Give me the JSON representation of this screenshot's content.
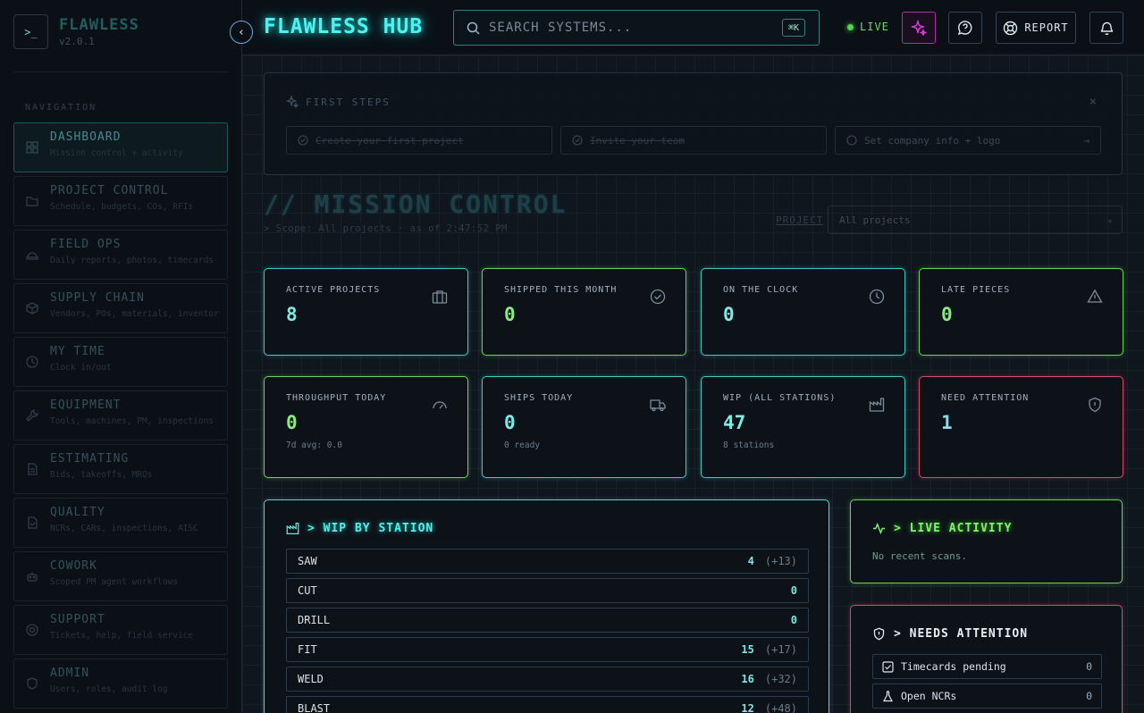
{
  "brand": {
    "name": "FLAWLESS",
    "version": "v2.0.1",
    "icon": ">_"
  },
  "sidebar": {
    "nav_title": "NAVIGATION",
    "items": [
      {
        "label": "DASHBOARD",
        "sub": "Mission control + activity",
        "icon": "grid-icon",
        "active": true
      },
      {
        "label": "PROJECT CONTROL",
        "sub": "Schedule, budgets, COs, RFIs",
        "icon": "folder-icon"
      },
      {
        "label": "FIELD OPS",
        "sub": "Daily reports, photos, timecards",
        "icon": "hardhat-icon"
      },
      {
        "label": "SUPPLY CHAIN",
        "sub": "Vendors, POs, materials, inventory",
        "icon": "package-icon"
      },
      {
        "label": "MY TIME",
        "sub": "Clock in/out",
        "icon": "clock-icon"
      },
      {
        "label": "EQUIPMENT",
        "sub": "Tools, machines, PM, inspections",
        "icon": "wrench-icon"
      },
      {
        "label": "ESTIMATING",
        "sub": "Bids, takeoffs, MRQs",
        "icon": "document-icon"
      },
      {
        "label": "QUALITY",
        "sub": "NCRs, CARs, inspections, AISC",
        "icon": "file-check-icon"
      },
      {
        "label": "COWORK",
        "sub": "Scoped PM agent workflows",
        "icon": "bot-icon"
      },
      {
        "label": "SUPPORT",
        "sub": "Tickets, help, field service",
        "icon": "lifebuoy-icon"
      },
      {
        "label": "ADMIN",
        "sub": "Users, roles, audit log",
        "icon": "shield-icon"
      }
    ]
  },
  "header": {
    "title": "FLAWLESS HUB",
    "search_placeholder": "SEARCH SYSTEMS...",
    "search_shortcut": "⌘K",
    "live_label": "LIVE",
    "report_label": "REPORT",
    "collapse_glyph": "‹"
  },
  "first_steps": {
    "title": "FIRST STEPS",
    "close": "×",
    "steps": [
      {
        "label": "Create your first project",
        "done": true
      },
      {
        "label": "Invite your team",
        "done": true
      },
      {
        "label": "Set company info + logo",
        "done": false,
        "arrow": "→"
      }
    ]
  },
  "mission": {
    "title": "// MISSION CONTROL",
    "scope": "> Scope: All projects · as of 2:47:52 PM",
    "project_label": "PROJECT",
    "project_value": "All projects"
  },
  "stats": [
    {
      "label": "ACTIVE PROJECTS",
      "value": "8",
      "sub": "",
      "color": "cyan",
      "icon": "briefcase-icon"
    },
    {
      "label": "SHIPPED THIS MONTH",
      "value": "0",
      "sub": "",
      "color": "green",
      "icon": "check-circle-icon"
    },
    {
      "label": "ON THE CLOCK",
      "value": "0",
      "sub": "",
      "color": "cyan",
      "icon": "clock-icon"
    },
    {
      "label": "LATE PIECES",
      "value": "0",
      "sub": "",
      "color": "green",
      "icon": "warning-triangle-icon"
    },
    {
      "label": "THROUGHPUT TODAY",
      "value": "0",
      "sub": "7d avg: 0.0",
      "color": "green",
      "icon": "gauge-icon"
    },
    {
      "label": "SHIPS TODAY",
      "value": "0",
      "sub": "0 ready",
      "color": "cyan",
      "icon": "truck-icon"
    },
    {
      "label": "WIP (ALL STATIONS)",
      "value": "47",
      "sub": "8 stations",
      "color": "cyan",
      "icon": "factory-icon"
    },
    {
      "label": "NEED ATTENTION",
      "value": "1",
      "sub": "",
      "color": "red",
      "icon": "shield-alert-icon"
    }
  ],
  "wip": {
    "title": "> WIP BY STATION",
    "rows": [
      {
        "station": "SAW",
        "count": "4",
        "delta": "(+13)"
      },
      {
        "station": "CUT",
        "count": "0",
        "delta": ""
      },
      {
        "station": "DRILL",
        "count": "0",
        "delta": ""
      },
      {
        "station": "FIT",
        "count": "15",
        "delta": "(+17)"
      },
      {
        "station": "WELD",
        "count": "16",
        "delta": "(+32)"
      },
      {
        "station": "BLAST",
        "count": "12",
        "delta": "(+48)"
      }
    ]
  },
  "live_activity": {
    "title": "> LIVE ACTIVITY",
    "empty": "No recent scans."
  },
  "needs_attention": {
    "title": "> NEEDS ATTENTION",
    "rows": [
      {
        "label": "Timecards pending",
        "value": "0",
        "icon": "checkbox-icon"
      },
      {
        "label": "Open NCRs",
        "value": "0",
        "icon": "flask-icon"
      }
    ]
  },
  "colors": {
    "cyan": "#41c9c5",
    "green": "#69d45a",
    "red": "#d54a6a",
    "magenta": "#e23dde",
    "bg": "#0d1219"
  }
}
